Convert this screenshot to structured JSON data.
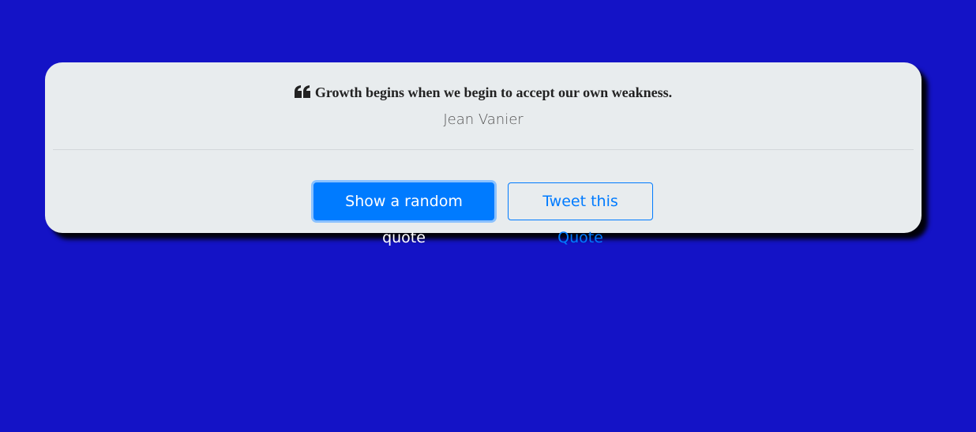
{
  "quote": {
    "text": "Growth begins when we begin to accept our own weakness.",
    "author": "Jean Vanier",
    "icon": "quote-left-icon"
  },
  "actions": {
    "random_label": "Show a random quote",
    "tweet_label": "Tweet this Quote"
  },
  "colors": {
    "background": "#1413c6",
    "card": "#e8ecee",
    "primary": "#007bff"
  }
}
